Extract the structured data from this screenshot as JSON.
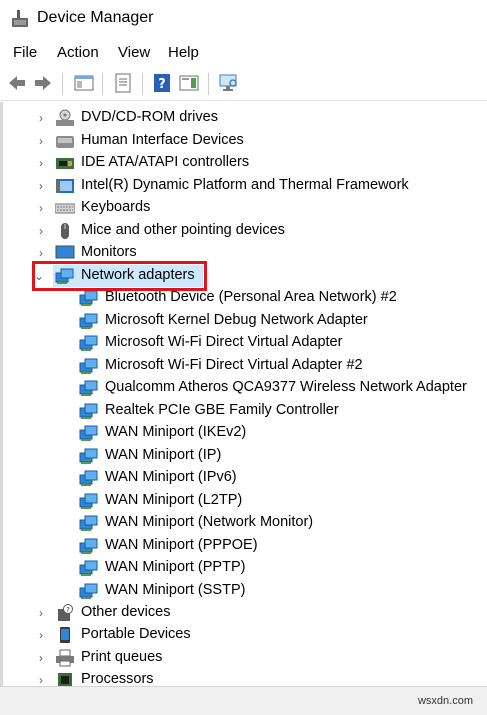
{
  "window": {
    "title": "Device Manager"
  },
  "menu": [
    "File",
    "Action",
    "View",
    "Help"
  ],
  "toolbar": {
    "buttons": [
      "back-arrow-icon",
      "forward-arrow-icon",
      "properties-console-icon",
      "properties-sheet-icon",
      "help-icon",
      "action-pane-icon",
      "scan-hardware-icon"
    ]
  },
  "tree": {
    "categories_before": [
      {
        "label": "DVD/CD-ROM drives",
        "icon": "dvd-drive-icon"
      },
      {
        "label": "Human Interface Devices",
        "icon": "hid-icon"
      },
      {
        "label": "IDE ATA/ATAPI controllers",
        "icon": "ide-controller-icon"
      },
      {
        "label": "Intel(R) Dynamic Platform and Thermal Framework",
        "icon": "intel-framework-icon"
      },
      {
        "label": "Keyboards",
        "icon": "keyboard-icon"
      },
      {
        "label": "Mice and other pointing devices",
        "icon": "mouse-icon"
      },
      {
        "label": "Monitors",
        "icon": "monitor-icon"
      }
    ],
    "expanded": {
      "label": "Network adapters",
      "icon": "network-adapter-icon",
      "children": [
        "Bluetooth Device (Personal Area Network) #2",
        "Microsoft Kernel Debug Network Adapter",
        "Microsoft Wi-Fi Direct Virtual Adapter",
        "Microsoft Wi-Fi Direct Virtual Adapter #2",
        "Qualcomm Atheros QCA9377 Wireless Network Adapter",
        "Realtek PCIe GBE Family Controller",
        "WAN Miniport (IKEv2)",
        "WAN Miniport (IP)",
        "WAN Miniport (IPv6)",
        "WAN Miniport (L2TP)",
        "WAN Miniport (Network Monitor)",
        "WAN Miniport (PPPOE)",
        "WAN Miniport (PPTP)",
        "WAN Miniport (SSTP)"
      ]
    },
    "categories_after": [
      {
        "label": "Other devices",
        "icon": "other-devices-icon"
      },
      {
        "label": "Portable Devices",
        "icon": "portable-device-icon"
      },
      {
        "label": "Print queues",
        "icon": "printer-icon"
      },
      {
        "label": "Processors",
        "icon": "processor-icon"
      }
    ]
  },
  "statusbar": {
    "watermark": "wsxdn.com"
  },
  "colors": {
    "selection": "#cce8ff",
    "highlight_box": "#e0151b"
  }
}
